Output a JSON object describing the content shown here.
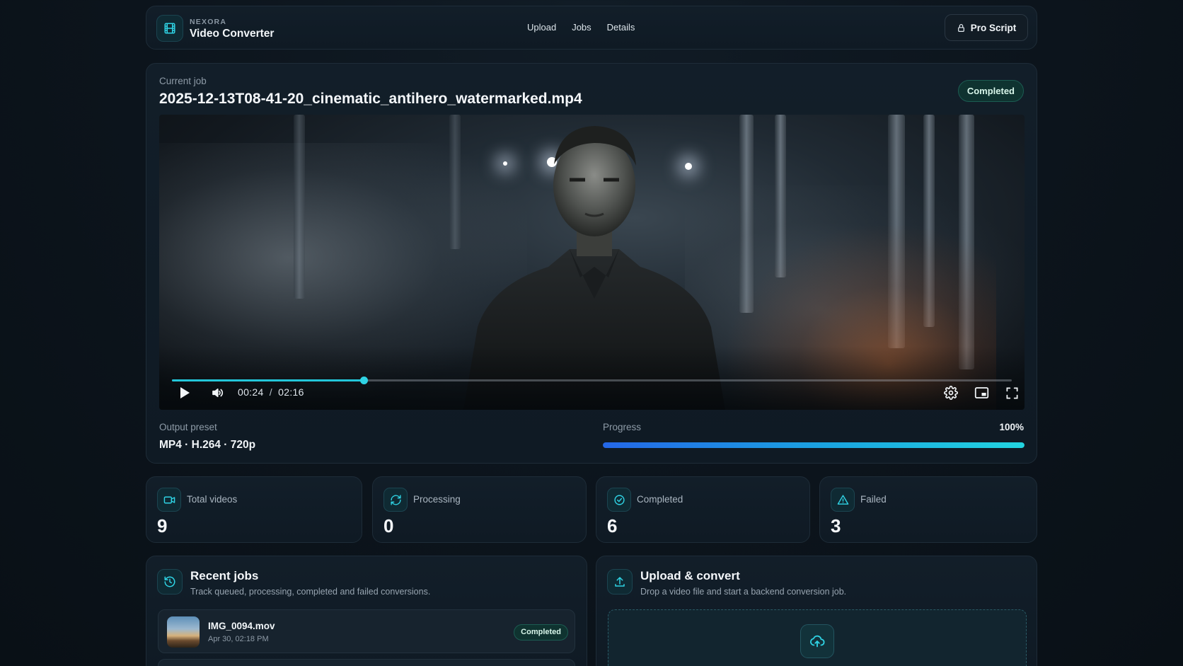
{
  "header": {
    "brand_small": "NEXORA",
    "brand_title": "Video Converter",
    "nav": [
      "Upload",
      "Jobs",
      "Details"
    ],
    "pro_button": "Pro Script"
  },
  "job": {
    "label": "Current job",
    "filename": "2025-12-13T08-41-20_cinematic_antihero_watermarked.mp4",
    "status": "Completed",
    "player": {
      "current_time": "00:24",
      "separator": "/",
      "duration": "02:16",
      "played_fraction": 0.228
    },
    "output_label": "Output preset",
    "output_value": "MP4 · H.264 · 720p",
    "progress_label": "Progress",
    "progress_text": "100%",
    "progress_value": 100
  },
  "stats": [
    {
      "label": "Total videos",
      "value": "9",
      "icon": "video-camera-icon"
    },
    {
      "label": "Processing",
      "value": "0",
      "icon": "refresh-icon"
    },
    {
      "label": "Completed",
      "value": "6",
      "icon": "check-circle-icon"
    },
    {
      "label": "Failed",
      "value": "3",
      "icon": "warning-triangle-icon"
    }
  ],
  "recent": {
    "title": "Recent jobs",
    "subtitle": "Track queued, processing, completed and failed conversions.",
    "items": [
      {
        "name": "IMG_0094.mov",
        "date": "Apr 30, 02:18 PM",
        "status": "Completed"
      }
    ]
  },
  "upload": {
    "title": "Upload & convert",
    "subtitle": "Drop a video file and start a backend conversion job."
  },
  "colors": {
    "accent": "#22d4e0",
    "progress_start": "#2467e8",
    "success_bg": "#0f3330",
    "background": "#0c141c"
  }
}
